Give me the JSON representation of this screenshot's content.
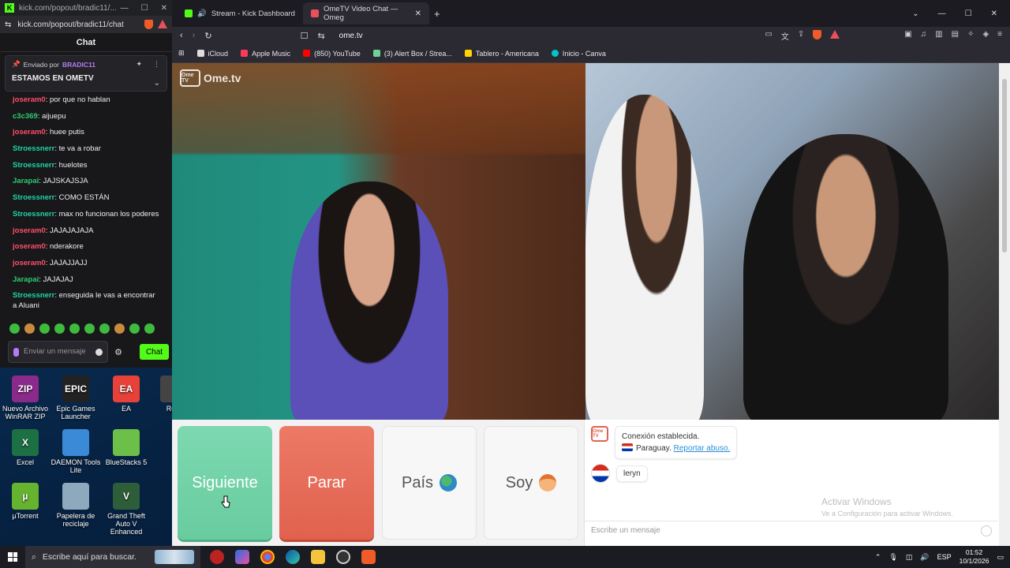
{
  "chat_window": {
    "title": "kick.com/popout/bradic11/...",
    "url": "kick.com/popout/bradic11/chat",
    "header": "Chat",
    "pinned": {
      "sent_by_label": "Enviado por",
      "user": "BRADIC11",
      "message": "ESTAMOS EN OMETV"
    },
    "messages": [
      {
        "user": "joseram0",
        "text": ": por que no hablan",
        "color": "red"
      },
      {
        "user": "c3c369",
        "text": ": aijuepu",
        "color": "green"
      },
      {
        "user": "joseram0",
        "text": ": huee putis",
        "color": "red"
      },
      {
        "user": "Stroessnerr",
        "text": ": te va a robar",
        "color": "teal"
      },
      {
        "user": "Stroessnerr",
        "text": ": huelotes",
        "color": "teal"
      },
      {
        "user": "Jarapai",
        "text": ": JAJSKAJSJA",
        "color": "green"
      },
      {
        "user": "Stroessnerr",
        "text": ": COMO ESTÁN",
        "color": "teal"
      },
      {
        "user": "Stroessnerr",
        "text": ": max no funcionan los poderes",
        "color": "teal"
      },
      {
        "user": "joseram0",
        "text": ": JAJAJAJAJA",
        "color": "red"
      },
      {
        "user": "joseram0",
        "text": ": nderakore",
        "color": "red"
      },
      {
        "user": "joseram0",
        "text": ": JAJAJJAJJ",
        "color": "red"
      },
      {
        "user": "Jarapai",
        "text": ": JAJAJAJ",
        "color": "green"
      },
      {
        "user": "Stroessnerr",
        "text": ": enseguida le vas a encontrar a Aluani",
        "color": "teal"
      }
    ],
    "input_placeholder": "Enviar un mensaje",
    "send_label": "Chat"
  },
  "desktop_icons": [
    {
      "label": "Nuevo Archivo WinRAR ZIP",
      "icon": "winrar-icon",
      "color": "#8a2a8a",
      "short": "ZIP"
    },
    {
      "label": "Epic Games Launcher",
      "icon": "epic-icon",
      "color": "#222222",
      "short": "EPIC"
    },
    {
      "label": "EA",
      "icon": "ea-icon",
      "color": "#e8413a",
      "short": "EA"
    },
    {
      "label": "Robl",
      "icon": "roblox-icon",
      "color": "#444444",
      "short": ""
    },
    {
      "label": "Excel",
      "icon": "excel-icon",
      "color": "#1d7044",
      "short": "X"
    },
    {
      "label": "DAEMON Tools Lite",
      "icon": "daemon-icon",
      "color": "#3a8ad8",
      "short": ""
    },
    {
      "label": "BlueStacks 5",
      "icon": "bluestacks-icon",
      "color": "#6cc04a",
      "short": ""
    },
    {
      "label": "µTorrent",
      "icon": "utorrent-icon",
      "color": "#65b32e",
      "short": "µ"
    },
    {
      "label": "Papelera de reciclaje",
      "icon": "recycle-bin-icon",
      "color": "#8ea8bd",
      "short": ""
    },
    {
      "label": "Grand Theft Auto V Enhanced",
      "icon": "gta-icon",
      "color": "#2e5d3a",
      "short": "V"
    }
  ],
  "browser": {
    "tabs": [
      {
        "label": "Stream - Kick Dashboard",
        "icon": "kick-icon",
        "color": "#53fc18"
      },
      {
        "label": "OmeTV Video Chat — Omeg",
        "icon": "ometv-icon",
        "color": "#e8505b"
      }
    ],
    "url": "ome.tv",
    "bookmarks": [
      {
        "label": "iCloud",
        "icon": "apple-icon",
        "color": "#dddddd"
      },
      {
        "label": "Apple Music",
        "icon": "music-icon",
        "color": "#fa3c5a"
      },
      {
        "label": "(850) YouTube",
        "icon": "youtube-icon",
        "color": "#ff0000"
      },
      {
        "label": "(3) Alert Box / Strea...",
        "icon": "alertbox-icon",
        "color": "#6fcf97"
      },
      {
        "label": "Tablero - Americana",
        "icon": "tablero-icon",
        "color": "#ffd400"
      },
      {
        "label": "Inicio - Canva",
        "icon": "canva-icon",
        "color": "#00c4cc"
      }
    ]
  },
  "ometv": {
    "logo": "Ome.tv",
    "logo_badge": "Ome TV",
    "buttons": {
      "next": "Siguiente",
      "stop": "Parar",
      "country": "País",
      "gender": "Soy"
    },
    "system_message": {
      "status": "Conexión establecida.",
      "country": "Paraguay.",
      "report": "Reportar abuso."
    },
    "peer_message": "leryn",
    "input_placeholder": "Escribe un mensaje",
    "watermark_title": "Activar Windows",
    "watermark_sub": "Ve a Configuración para activar Windows."
  },
  "taskbar": {
    "search_placeholder": "Escribe aquí para buscar.",
    "language": "ESP",
    "time": "01:52",
    "date": "10/1/2026"
  }
}
